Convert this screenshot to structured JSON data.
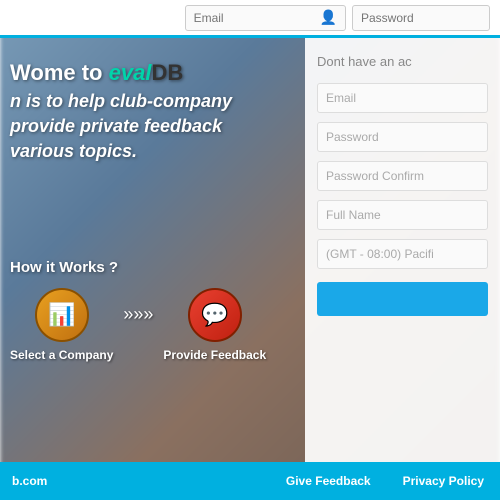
{
  "topnav": {
    "email_placeholder": "Email",
    "password_placeholder": "Password"
  },
  "hero": {
    "welcome_prefix": "ome to",
    "brand_eval": "eval",
    "brand_db": "DB",
    "line1": "n is to help club-company",
    "line2": "provide private feedback",
    "line3": "various topics."
  },
  "how_it_works": {
    "title": "How it Works ?",
    "steps": [
      {
        "label": "Select a Company",
        "icon": "📊"
      },
      {
        "label": "Provide Feedback",
        "icon": "💬"
      }
    ],
    "arrow": "»»»"
  },
  "registration": {
    "title": "Dont have an ac",
    "email_placeholder": "Email",
    "password_placeholder": "Password",
    "confirm_placeholder": "Password Confirm",
    "fullname_placeholder": "Full Name",
    "timezone_placeholder": "(GMT - 08:00) Pacifi",
    "button_label": ""
  },
  "footer": {
    "domain": "b.com",
    "give_feedback": "Give Feedback",
    "privacy_policy": "Privacy Policy"
  }
}
